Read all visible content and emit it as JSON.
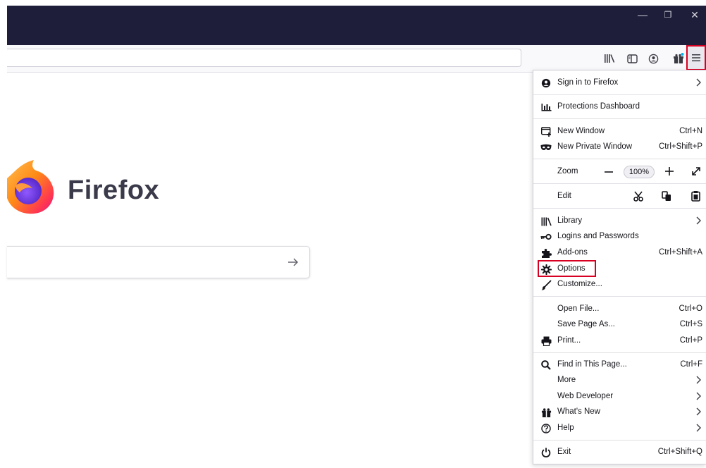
{
  "window": {
    "minimize_glyph": "—",
    "restore_glyph": "❐",
    "close_glyph": "✕"
  },
  "toolbar": {
    "icons": [
      "library-icon",
      "sidebar-icon",
      "account-icon",
      "whats-new-icon",
      "hamburger-menu-icon"
    ]
  },
  "newtab": {
    "brand": "Firefox"
  },
  "menu": {
    "sign_in": "Sign in to Firefox",
    "protections": "Protections Dashboard",
    "new_window": "New Window",
    "new_window_sc": "Ctrl+N",
    "new_private": "New Private Window",
    "new_private_sc": "Ctrl+Shift+P",
    "zoom": "Zoom",
    "zoom_level": "100%",
    "edit": "Edit",
    "library": "Library",
    "logins": "Logins and Passwords",
    "addons": "Add-ons",
    "addons_sc": "Ctrl+Shift+A",
    "options": "Options",
    "customize": "Customize...",
    "open_file": "Open File...",
    "open_file_sc": "Ctrl+O",
    "save_page": "Save Page As...",
    "save_page_sc": "Ctrl+S",
    "print": "Print...",
    "print_sc": "Ctrl+P",
    "find": "Find in This Page...",
    "find_sc": "Ctrl+F",
    "more": "More",
    "web_dev": "Web Developer",
    "whats_new": "What's New",
    "help": "Help",
    "exit": "Exit",
    "exit_sc": "Ctrl+Shift+Q"
  },
  "colors": {
    "titlebar": "#1f1e3a",
    "highlight": "#d70022"
  }
}
